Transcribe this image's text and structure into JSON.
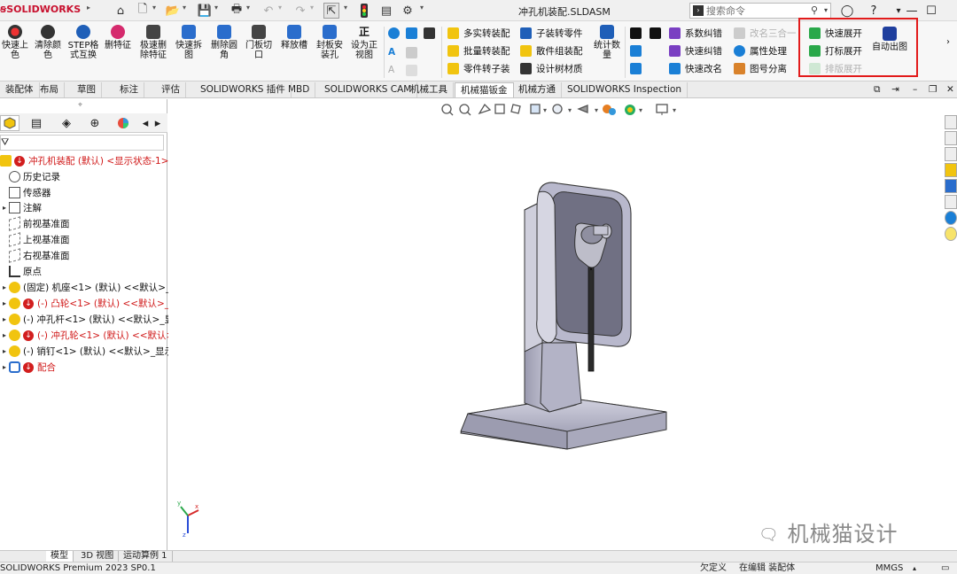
{
  "app": {
    "logo": "SOLIDWORKS",
    "doc_title": "冲孔机装配.SLDASM",
    "search_placeholder": "搜索命令"
  },
  "ribbon": {
    "big_buttons": [
      {
        "label": "快速上色",
        "icon": "paint-icon"
      },
      {
        "label": "清除颜色",
        "icon": "paint-clear-icon"
      },
      {
        "label": "STEP格式互换",
        "icon": "step-icon"
      },
      {
        "label": "删特征",
        "icon": "delete-feature-icon"
      },
      {
        "label": "极速删除特征",
        "icon": "fast-delete-icon"
      },
      {
        "label": "快速拆图",
        "icon": "split-drawing-icon"
      },
      {
        "label": "删除圆角",
        "icon": "delete-fillet-icon"
      },
      {
        "label": "门板切口",
        "icon": "door-cut-icon"
      },
      {
        "label": "释放槽",
        "icon": "relief-slot-icon"
      },
      {
        "label": "封板安装孔",
        "icon": "mount-hole-icon"
      },
      {
        "label": "设为正视图",
        "icon": "normal-view-icon"
      }
    ],
    "group1": [
      "多实转装配",
      "批量转装配",
      "零件转子装"
    ],
    "group2": [
      "子装转零件",
      "散件组装配",
      "设计树材质"
    ],
    "stats_label": "统计数量",
    "group3": [
      "系数纠错",
      "快速纠错",
      "快速改名"
    ],
    "group4": [
      "改名三合一",
      "属性处理",
      "图号分离"
    ],
    "group4_disabled": [
      true,
      false,
      false
    ],
    "group5": [
      "快速展开",
      "打标展开",
      "排版展开"
    ],
    "group5_disabled": [
      false,
      false,
      true
    ],
    "auto_drawing_label": "自动出图"
  },
  "tabs": [
    {
      "label": "装配体",
      "active": false
    },
    {
      "label": "布局",
      "active": false
    },
    {
      "label": "草图",
      "active": false
    },
    {
      "label": "标注",
      "active": false
    },
    {
      "label": "评估",
      "active": false
    },
    {
      "label": "SOLIDWORKS 插件",
      "active": false
    },
    {
      "label": "MBD",
      "active": false
    },
    {
      "label": "SOLIDWORKS CAM",
      "active": false
    },
    {
      "label": "机械工具",
      "active": false
    },
    {
      "label": "机械猫钣金",
      "active": true
    },
    {
      "label": "机械方通",
      "active": false
    },
    {
      "label": "SOLIDWORKS Inspection",
      "active": false
    }
  ],
  "tree": {
    "root": "冲孔机装配 (默认) <显示状态-1>",
    "items": [
      {
        "label": "历史记录",
        "icon": "history-icon"
      },
      {
        "label": "传感器",
        "icon": "sensor-icon"
      },
      {
        "label": "注解",
        "icon": "annotation-icon"
      },
      {
        "label": "前视基准面",
        "icon": "plane-icon"
      },
      {
        "label": "上视基准面",
        "icon": "plane-icon"
      },
      {
        "label": "右视基准面",
        "icon": "plane-icon"
      },
      {
        "label": "原点",
        "icon": "origin-icon"
      },
      {
        "label": "(固定) 机座<1> (默认) <<默认>_显",
        "icon": "part-icon",
        "error": false
      },
      {
        "label": "(-) 凸轮<1> (默认) <<默认>_显",
        "icon": "part-icon",
        "error": true
      },
      {
        "label": "(-) 冲孔杆<1> (默认) <<默认>_显示",
        "icon": "part-icon",
        "error": false
      },
      {
        "label": "(-) 冲孔轮<1> (默认) <<默认>_显",
        "icon": "part-icon",
        "error": true
      },
      {
        "label": "(-) 销钉<1> (默认) <<默认>_显示",
        "icon": "part-icon",
        "error": false
      },
      {
        "label": "配合",
        "icon": "mate-icon",
        "error": true
      }
    ]
  },
  "bottom_tabs": [
    "模型",
    "3D 视图",
    "运动算例 1"
  ],
  "status": {
    "product": "SOLIDWORKS Premium 2023 SP0.1",
    "undefined": "欠定义",
    "editing": "在编辑 装配体",
    "units": "MMGS"
  },
  "watermark": "机械猫设计",
  "colors": {
    "accent_red": "#e21b1b",
    "model_body": "#b9b9c9",
    "tree_error": "#d01818"
  }
}
